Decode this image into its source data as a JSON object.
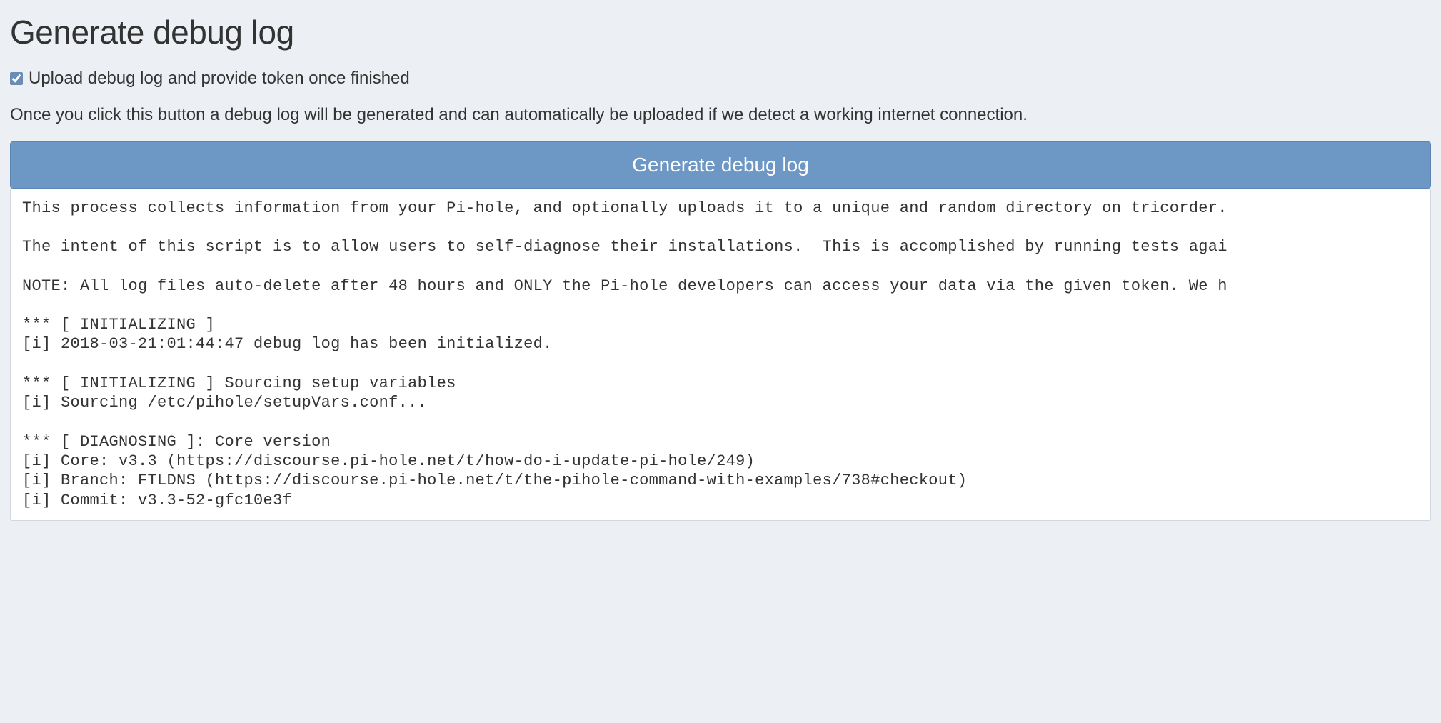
{
  "header": {
    "title": "Generate debug log"
  },
  "options": {
    "upload_checkbox_label": "Upload debug log and provide token once finished",
    "upload_checked": true
  },
  "description": "Once you click this button a debug log will be generated and can automatically be uploaded if we detect a working internet connection.",
  "button": {
    "label": "Generate debug log"
  },
  "log": {
    "text": "This process collects information from your Pi-hole, and optionally uploads it to a unique and random directory on tricorder.\n\nThe intent of this script is to allow users to self-diagnose their installations.  This is accomplished by running tests agai\n\nNOTE: All log files auto-delete after 48 hours and ONLY the Pi-hole developers can access your data via the given token. We h\n\n*** [ INITIALIZING ]\n[i] 2018-03-21:01:44:47 debug log has been initialized.\n\n*** [ INITIALIZING ] Sourcing setup variables\n[i] Sourcing /etc/pihole/setupVars.conf...\n\n*** [ DIAGNOSING ]: Core version\n[i] Core: v3.3 (https://discourse.pi-hole.net/t/how-do-i-update-pi-hole/249)\n[i] Branch: FTLDNS (https://discourse.pi-hole.net/t/the-pihole-command-with-examples/738#checkout)\n[i] Commit: v3.3-52-gfc10e3f"
  }
}
